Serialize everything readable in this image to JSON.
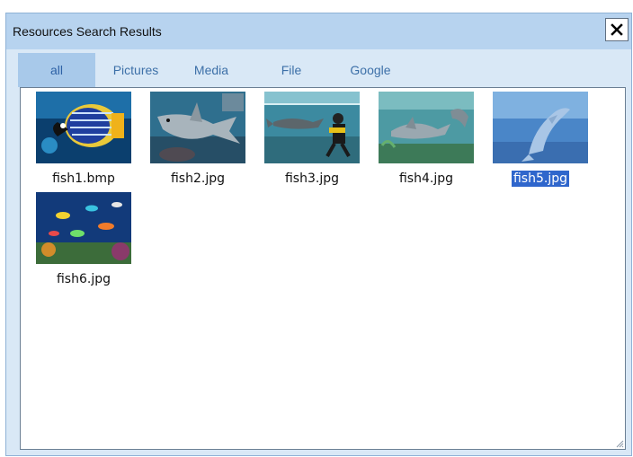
{
  "window": {
    "title": "Resources Search Results"
  },
  "tabs": [
    {
      "label": "all",
      "active": true
    },
    {
      "label": "Pictures"
    },
    {
      "label": "Media"
    },
    {
      "label": "File"
    },
    {
      "label": "Google"
    }
  ],
  "results": [
    {
      "name": "fish1.bmp",
      "thumb": "angelfish"
    },
    {
      "name": "fish2.jpg",
      "thumb": "shark"
    },
    {
      "name": "fish3.jpg",
      "thumb": "diver-with-shark"
    },
    {
      "name": "fish4.jpg",
      "thumb": "dolphins"
    },
    {
      "name": "fish5.jpg",
      "thumb": "dolphin-jumping",
      "selected": true
    },
    {
      "name": "fish6.jpg",
      "thumb": "reef-fish"
    }
  ],
  "colors": {
    "window_bg": "#d9e8f6",
    "titlebar": "#b7d3ef",
    "active_tab": "#a8c9ea",
    "selection": "#2f66cc"
  }
}
